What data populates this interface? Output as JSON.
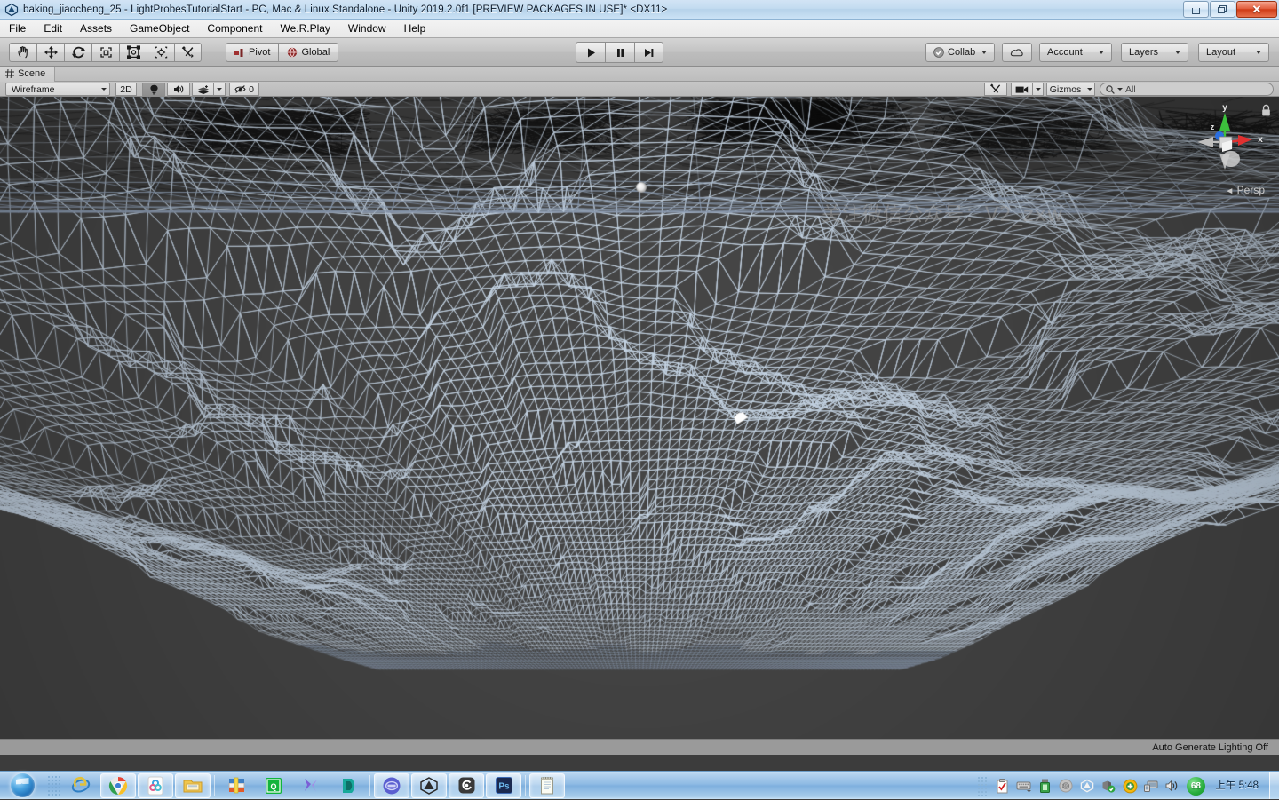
{
  "window": {
    "title": "baking_jiaocheng_25 - LightProbesTutorialStart - PC, Mac & Linux Standalone - Unity 2019.2.0f1 [PREVIEW PACKAGES IN USE]* <DX11>",
    "app_icon": "unity-icon",
    "controls": {
      "minimize": "minimize-icon",
      "restore": "restore-icon",
      "close": "✕"
    }
  },
  "menubar": {
    "items": [
      {
        "label": "File"
      },
      {
        "label": "Edit"
      },
      {
        "label": "Assets"
      },
      {
        "label": "GameObject"
      },
      {
        "label": "Component"
      },
      {
        "label": "We.R.Play"
      },
      {
        "label": "Window"
      },
      {
        "label": "Help"
      }
    ]
  },
  "toolbar": {
    "transform_tools": [
      {
        "name": "hand-tool",
        "icon": "hand-icon",
        "active": false
      },
      {
        "name": "move-tool",
        "icon": "move-icon",
        "active": false
      },
      {
        "name": "rotate-tool",
        "icon": "rotate-icon",
        "active": false
      },
      {
        "name": "scale-tool",
        "icon": "scale-icon",
        "active": false
      },
      {
        "name": "rect-tool",
        "icon": "rect-transform-icon",
        "active": false
      },
      {
        "name": "transform-tool",
        "icon": "transform-icon",
        "active": false
      },
      {
        "name": "custom-tool",
        "icon": "wrench-screwdriver-icon",
        "active": false
      }
    ],
    "pivot_label": "Pivot",
    "global_label": "Global",
    "play_controls": [
      {
        "name": "play-button",
        "icon": "play-icon"
      },
      {
        "name": "pause-button",
        "icon": "pause-icon"
      },
      {
        "name": "step-button",
        "icon": "step-icon"
      }
    ],
    "collab_label": "Collab",
    "cloud_label": "cloud-icon",
    "account_label": "Account",
    "layers_label": "Layers",
    "layout_label": "Layout"
  },
  "scene_tab": {
    "label": "Scene",
    "icon": "grid-icon"
  },
  "scene_toolbar": {
    "draw_mode": "Wireframe",
    "two_d_label": "2D",
    "lighting_icon": "lightbulb-icon",
    "audio_icon": "speaker-icon",
    "fx_icon": "effects-icon",
    "hidden_count": "0",
    "hidden_icon": "eye-off-icon",
    "tools_icon": "wrench-screwdriver-icon",
    "camera_icon": "camera-icon",
    "gizmos_label": "Gizmos",
    "search_placeholder": "All",
    "search_value": "",
    "search_icon": "search-icon"
  },
  "scene_view": {
    "watermark": "关注微信公众号：V2_zxw",
    "projection_label": "Persp",
    "projection_arrow": "◄",
    "lock_icon": "lock-icon",
    "axis_labels": {
      "x": "x",
      "y": "y",
      "z": "z"
    },
    "axis_colors": {
      "x": "#e03030",
      "y": "#3cc03c",
      "z": "#2a6fe0"
    },
    "background_color": "#454545",
    "wire_color": "#c3d2e2",
    "grid_color": "#8b9bb0",
    "status": "Auto Generate Lighting Off"
  },
  "taskbar": {
    "start_label": "start-orb",
    "quick_launch": [
      {
        "name": "internet-explorer-icon"
      },
      {
        "name": "google-chrome-icon",
        "pinned": true
      },
      {
        "name": "cloud-sync-icon",
        "pinned": true
      },
      {
        "name": "file-explorer-icon",
        "pinned": true
      },
      {
        "name": "winrar-icon"
      },
      {
        "name": "qq-app-icon"
      },
      {
        "name": "firefox-variant-icon"
      },
      {
        "name": "teal-app-icon"
      }
    ],
    "running": [
      {
        "name": "blue-stamp-app-icon",
        "pinned": true
      },
      {
        "name": "unity-editor-icon",
        "pinned": true,
        "active": true
      },
      {
        "name": "spiral-app-icon",
        "pinned": true
      },
      {
        "name": "photoshop-icon",
        "label": "Ps",
        "pinned": true
      },
      {
        "name": "notepad-icon",
        "pinned": true
      }
    ],
    "tray": [
      {
        "name": "clipboard-icon"
      },
      {
        "name": "keyboard-ime-icon"
      },
      {
        "name": "tray-overflow-icon"
      },
      {
        "name": "usb-device-icon"
      },
      {
        "name": "gray-disc-icon"
      },
      {
        "name": "unity-hub-icon"
      },
      {
        "name": "security-shield-icon"
      },
      {
        "name": "antivirus-icon"
      },
      {
        "name": "network-icon"
      },
      {
        "name": "volume-icon"
      },
      {
        "name": "temperature-badge",
        "value": "68"
      }
    ],
    "clock": "上午 5:48"
  }
}
